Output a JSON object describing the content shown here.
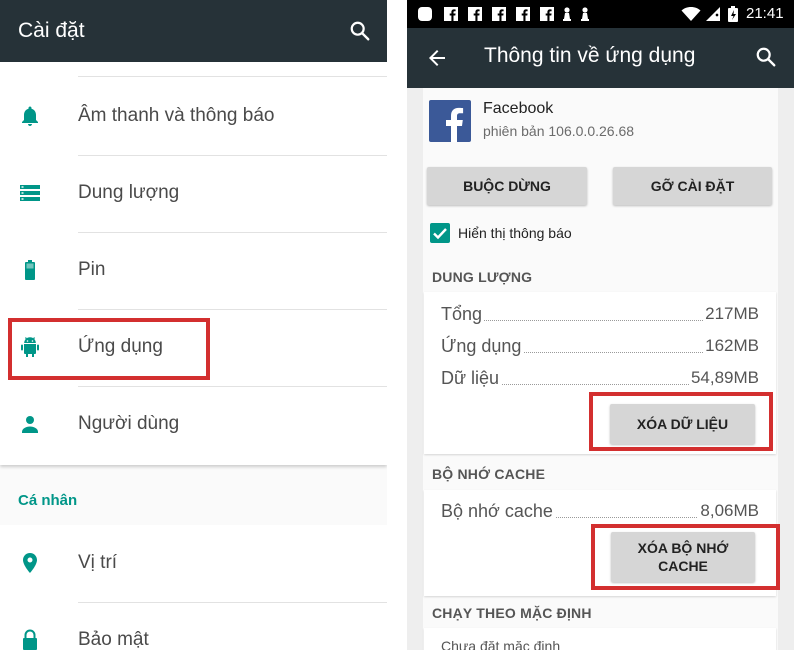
{
  "left": {
    "title": "Cài đặt",
    "items": [
      {
        "label": "Âm thanh và thông báo",
        "icon": "bell-icon"
      },
      {
        "label": "Dung lượng",
        "icon": "storage-icon"
      },
      {
        "label": "Pin",
        "icon": "battery-icon"
      },
      {
        "label": "Ứng dụng",
        "icon": "android-icon"
      },
      {
        "label": "Người dùng",
        "icon": "person-icon"
      }
    ],
    "section_personal": "Cá nhân",
    "personal_items": [
      {
        "label": "Vị trí",
        "icon": "location-icon"
      },
      {
        "label": "Bảo mật",
        "icon": "lock-icon"
      }
    ]
  },
  "status_bar": {
    "time": "21:41"
  },
  "right": {
    "title": "Thông tin về ứng dụng",
    "app": {
      "name": "Facebook",
      "version": "phiên bản 106.0.0.26.68"
    },
    "buttons": {
      "force_stop": "BUỘC DỪNG",
      "uninstall": "GỠ CÀI ĐẶT"
    },
    "show_notifications": {
      "label": "Hiển thị thông báo",
      "checked": true
    },
    "storage": {
      "header": "DUNG LƯỢNG",
      "rows": [
        {
          "label": "Tổng",
          "value": "217MB"
        },
        {
          "label": "Ứng dụng",
          "value": "162MB"
        },
        {
          "label": "Dữ liệu",
          "value": "54,89MB"
        }
      ],
      "clear_data": "XÓA DỮ LIỆU"
    },
    "cache": {
      "header": "BỘ NHỚ CACHE",
      "label": "Bộ nhớ cache",
      "value": "8,06MB",
      "clear_cache": "XÓA BỘ NHỚ CACHE"
    },
    "defaults": {
      "header": "CHẠY THEO MẶC ĐỊNH",
      "status": "Chưa đặt mặc định"
    }
  },
  "colors": {
    "accent": "#009688",
    "appbar": "#263238",
    "highlight": "#d32f2f",
    "facebook": "#3b5998"
  }
}
